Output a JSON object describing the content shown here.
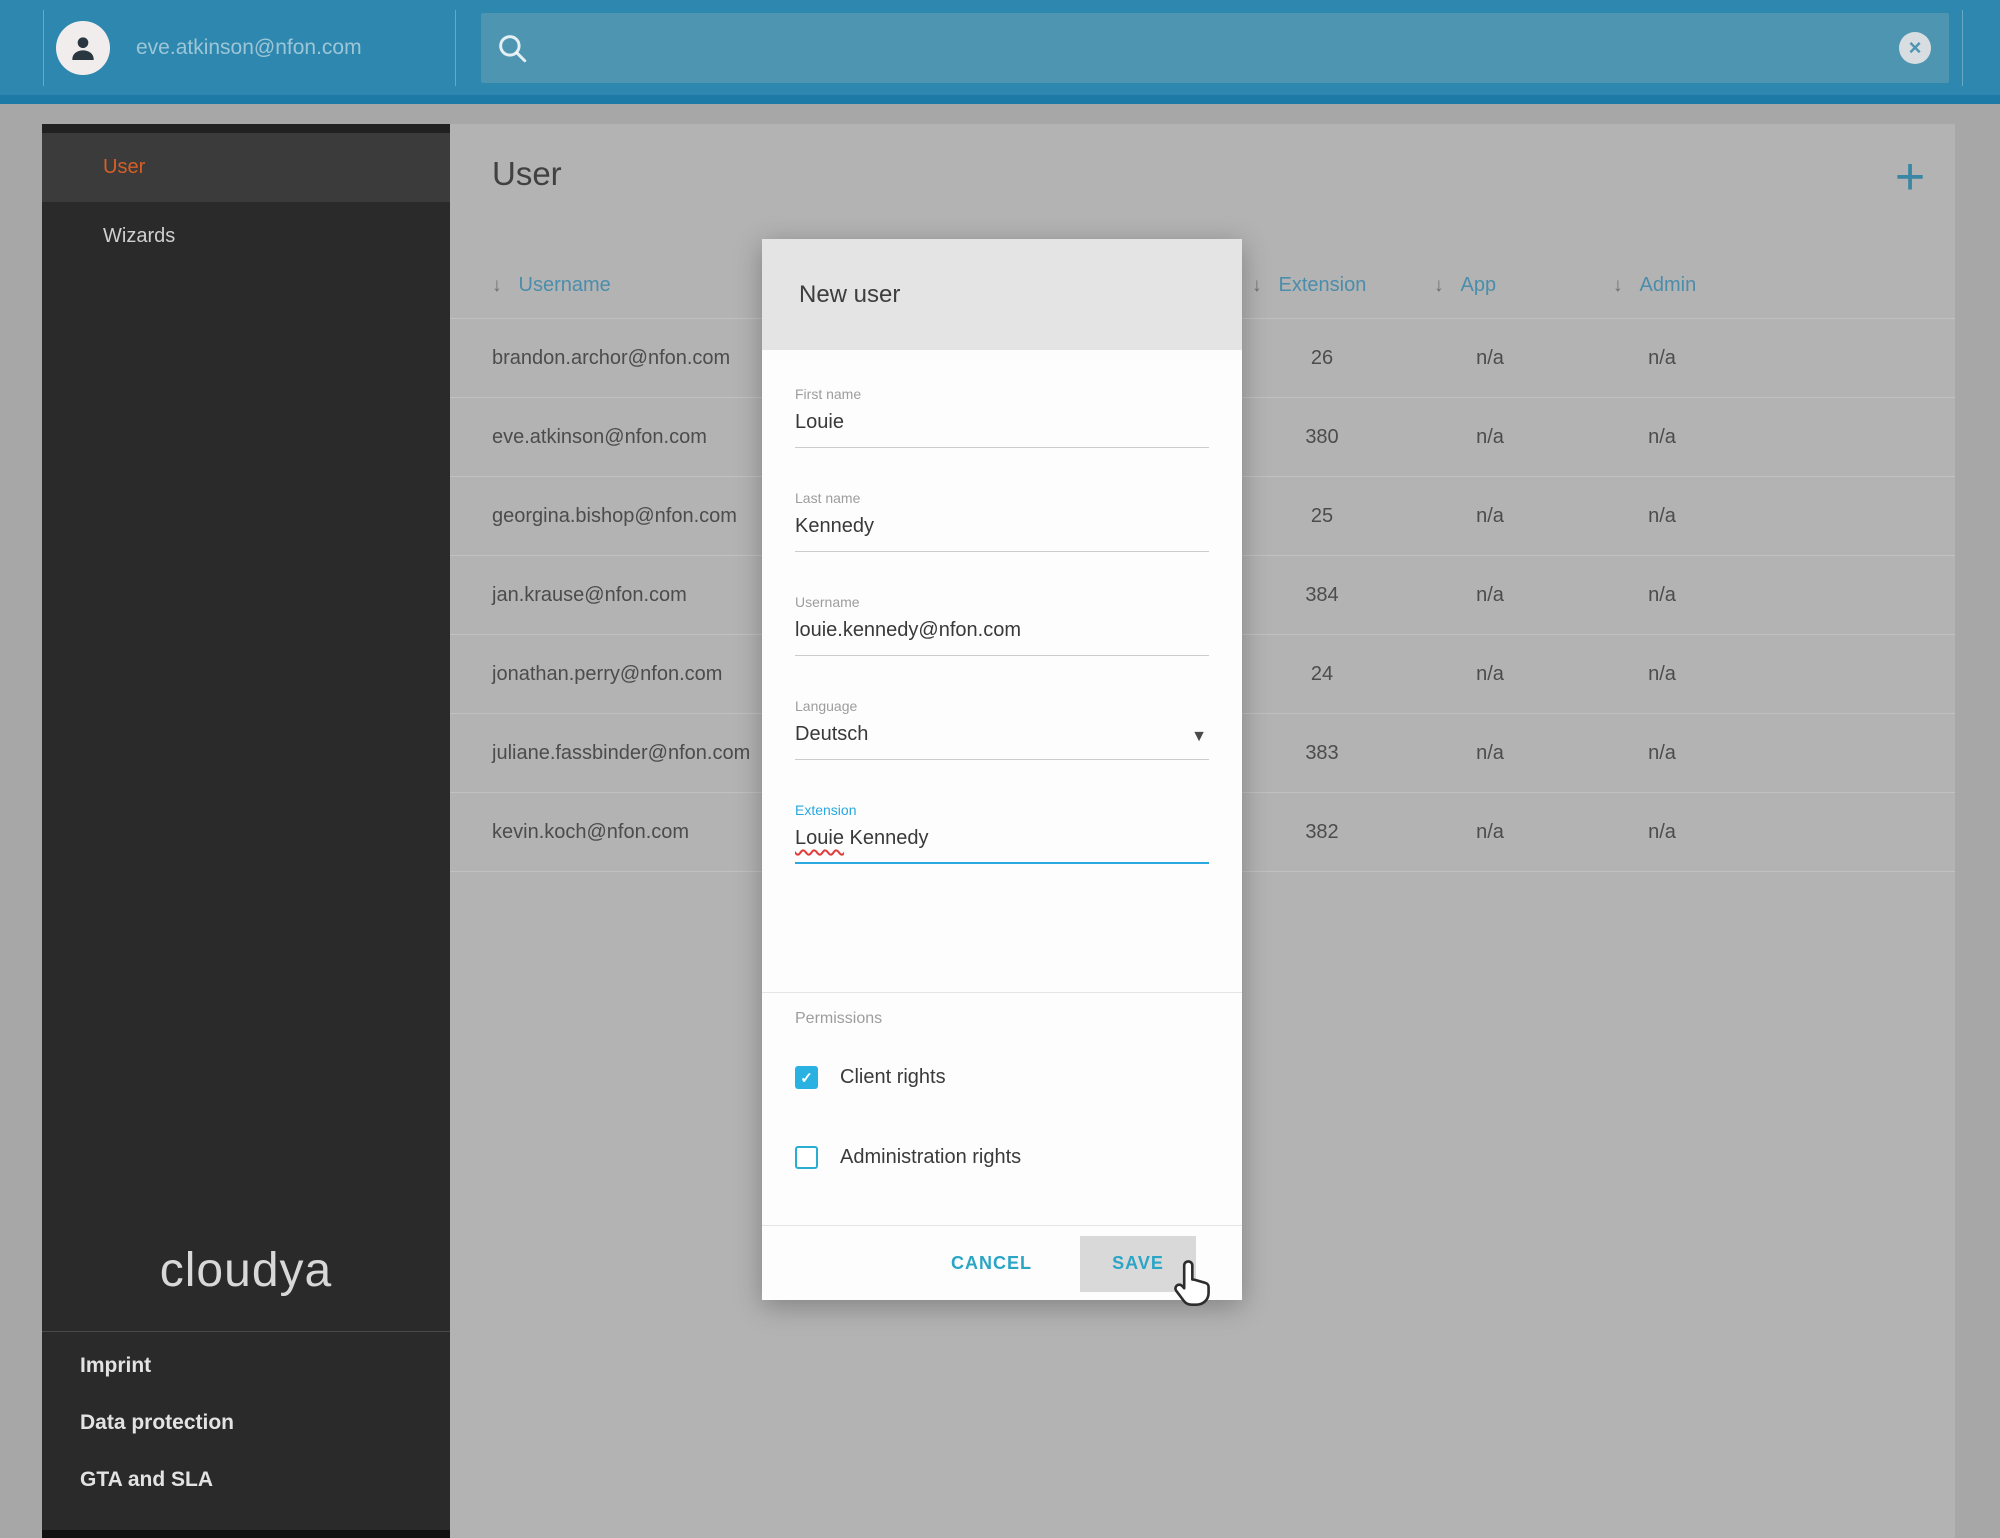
{
  "icons": {
    "sort": "↓",
    "dropdown_caret": "▼",
    "check": "✓",
    "clear": "×",
    "add": "+"
  },
  "colors": {
    "topbar": "#2e87ae",
    "accent_teal": "#2aa5c6",
    "focus_blue": "#29a9e0",
    "active_orange": "#d55f25"
  },
  "topbar": {
    "account_email": "eve.atkinson@nfon.com",
    "search_value": ""
  },
  "sidebar": {
    "items": [
      {
        "label": "User",
        "active": true
      },
      {
        "label": "Wizards",
        "active": false
      }
    ],
    "logo": "cloudya",
    "footer_links": [
      "Imprint",
      "Data protection",
      "GTA and SLA"
    ]
  },
  "main": {
    "title": "User",
    "table": {
      "columns": [
        "Username",
        "Extension",
        "App",
        "Admin"
      ],
      "rows": [
        {
          "username": "brandon.archor@nfon.com",
          "extension": "26",
          "app": "n/a",
          "admin": "n/a"
        },
        {
          "username": "eve.atkinson@nfon.com",
          "extension": "380",
          "app": "n/a",
          "admin": "n/a"
        },
        {
          "username": "georgina.bishop@nfon.com",
          "extension": "25",
          "app": "n/a",
          "admin": "n/a"
        },
        {
          "username": "jan.krause@nfon.com",
          "extension": "384",
          "app": "n/a",
          "admin": "n/a"
        },
        {
          "username": "jonathan.perry@nfon.com",
          "extension": "24",
          "app": "n/a",
          "admin": "n/a"
        },
        {
          "username": "juliane.fassbinder@nfon.com",
          "extension": "383",
          "app": "n/a",
          "admin": "n/a"
        },
        {
          "username": "kevin.koch@nfon.com",
          "extension": "382",
          "app": "n/a",
          "admin": "n/a"
        }
      ]
    }
  },
  "modal": {
    "title": "New user",
    "fields": [
      {
        "label": "First name",
        "value": "Louie",
        "type": "text"
      },
      {
        "label": "Last name",
        "value": "Kennedy",
        "type": "text"
      },
      {
        "label": "Username",
        "value": "louie.kennedy@nfon.com",
        "type": "text"
      },
      {
        "label": "Language",
        "value": "Deutsch",
        "type": "select"
      },
      {
        "label": "Extension",
        "value": "Louie Kennedy",
        "type": "text",
        "focused": true,
        "misspelled_word": "Louie"
      }
    ],
    "permissions": {
      "section_label": "Permissions",
      "checkboxes": [
        {
          "label": "Client rights",
          "checked": true
        },
        {
          "label": "Administration rights",
          "checked": false
        }
      ]
    },
    "buttons": {
      "cancel": "CANCEL",
      "save": "SAVE"
    }
  }
}
